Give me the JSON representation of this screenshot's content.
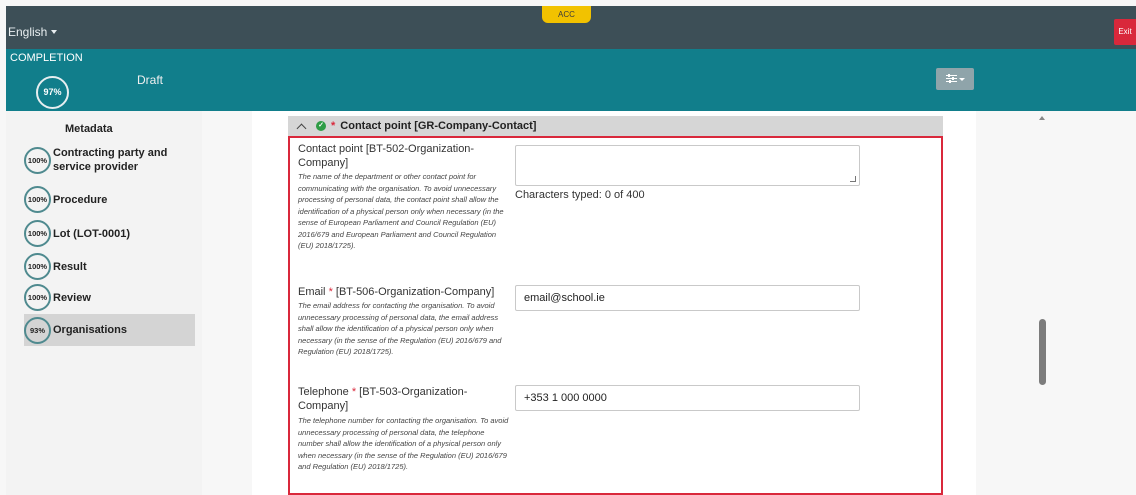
{
  "topbar": {
    "language": "English",
    "env_badge": "ACC",
    "exit_label": "Exit"
  },
  "status": {
    "completion_label": "COMPLETION",
    "percent": "97%",
    "state": "Draft"
  },
  "sidebar": {
    "metadata_label": "Metadata",
    "items": [
      {
        "percent": "100%",
        "label": "Contracting party and service provider"
      },
      {
        "percent": "100%",
        "label": "Procedure"
      },
      {
        "percent": "100%",
        "label": "Lot (LOT-0001)"
      },
      {
        "percent": "100%",
        "label": "Result"
      },
      {
        "percent": "100%",
        "label": "Review"
      },
      {
        "percent": "93%",
        "label": "Organisations"
      }
    ]
  },
  "section": {
    "title": "Contact point  [GR-Company-Contact]"
  },
  "fields": {
    "contact": {
      "label": "Contact point [BT-502-Organization-Company]",
      "help": "The name of the department or other contact point for communicating with the organisation. To avoid unnecessary processing of personal data, the contact point shall allow the identification of a physical person only when necessary (in the sense of European Parliament and Council Regulation (EU) 2016/679 and European Parliament and Council Regulation (EU) 2018/1725).",
      "value": "",
      "chars_typed": "Characters typed: 0 of 400"
    },
    "email": {
      "label_prefix": "Email ",
      "label_suffix": " [BT-506-Organization-Company]",
      "help": "The email address for contacting the organisation. To avoid unnecessary processing of personal data, the email address shall allow the identification of a physical person only when necessary (in the sense of the Regulation (EU) 2016/679 and Regulation (EU) 2018/1725).",
      "value": "email@school.ie"
    },
    "telephone": {
      "label_prefix": "Telephone ",
      "label_suffix": " [BT-503-Organization-Company]",
      "help": "The telephone number for contacting the organisation. To avoid unnecessary processing of personal data, the telephone number shall allow the identification of a physical person only when necessary (in the sense of the Regulation (EU) 2016/679 and Regulation (EU) 2018/1725).",
      "value": "+353 1 000 0000"
    },
    "required_mark": "*"
  },
  "icons": {
    "filter": "filter-sliders-icon",
    "check": "check-circle-icon"
  },
  "colors": {
    "topbar": "#3d4f57",
    "teal": "#117e8b",
    "exit": "#d9283b",
    "acc": "#f2c200",
    "highlight": "#d9283b"
  }
}
